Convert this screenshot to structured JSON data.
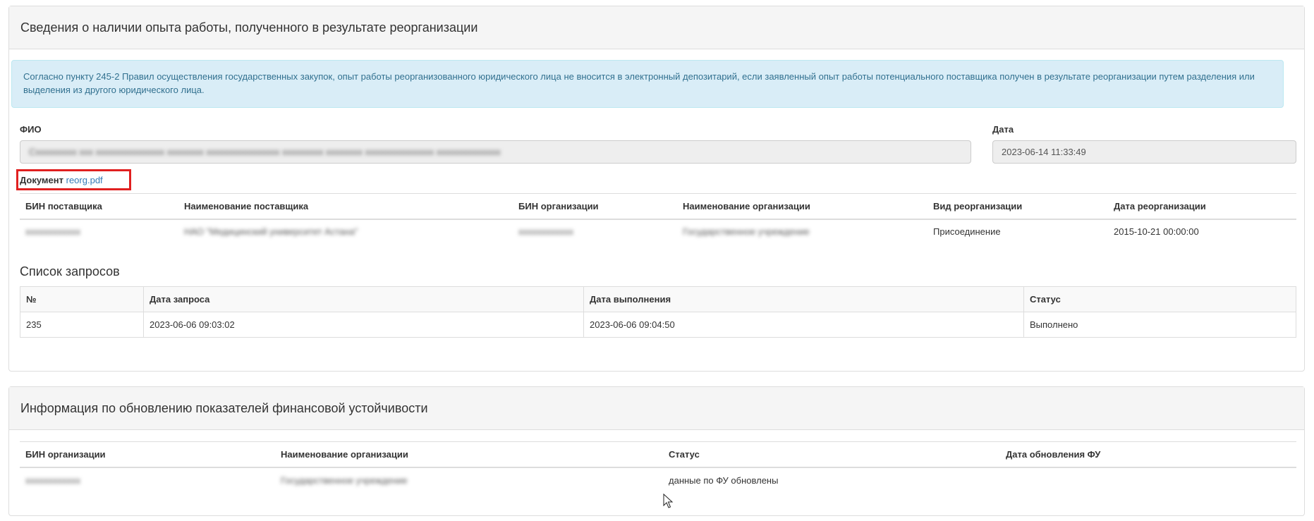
{
  "reorg_panel": {
    "title": "Сведения о наличии опыта работы, полученного в результате реорганизации",
    "alert_text": "Согласно пункту 245-2 Правил осуществления государственных закупок, опыт работы реорганизованного юридического лица не вносится в электронный депозитарий, если заявленный опыт работы потенциального поставщика получен в результате реорганизации путем разделения или выделения из другого юридического лица.",
    "fio_label": "ФИО",
    "fio_value": "Сxxxxxxxxx xxx xxxxxxxxxxxxxxx xxxxxxxx xxxxxxxxxxxxxxxx xxxxxxxxx xxxxxxxx xxxxxxxxxxxxxxx xxxxxxxxxxxxxx",
    "date_label": "Дата",
    "date_value": "2023-06-14 11:33:49",
    "document_label": "Документ",
    "document_link": "reorg.pdf",
    "table": {
      "headers": [
        "БИН поставщика",
        "Наименование поставщика",
        "БИН организации",
        "Наименование организации",
        "Вид реорганизации",
        "Дата реорганизации"
      ],
      "row": {
        "supplier_bin": "xxxxxxxxxxxx",
        "supplier_name": "НАО \"Медицинский университет Астана\"",
        "org_bin": "xxxxxxxxxxxx",
        "org_name": "Государственное учреждение",
        "reorg_type": "Присоединение",
        "reorg_date": "2015-10-21 00:00:00"
      }
    },
    "requests_title": "Список запросов",
    "requests": {
      "headers": [
        "№",
        "Дата запроса",
        "Дата выполнения",
        "Статус"
      ],
      "row": {
        "num": "235",
        "request_date": "2023-06-06 09:03:02",
        "done_date": "2023-06-06 09:04:50",
        "status": "Выполнено"
      }
    }
  },
  "fin_panel": {
    "title": "Информация по обновлению показателей финансовой устойчивости",
    "headers": [
      "БИН организации",
      "Наименование организации",
      "Статус",
      "Дата обновления ФУ"
    ],
    "row": {
      "org_bin": "xxxxxxxxxxxx",
      "org_name": "Государственное учреждение",
      "status": "данные по ФУ обновлены",
      "update_date": ""
    }
  },
  "colors": {
    "alert_bg": "#d9edf7",
    "link": "#337ab7",
    "highlight": "#e02020"
  }
}
